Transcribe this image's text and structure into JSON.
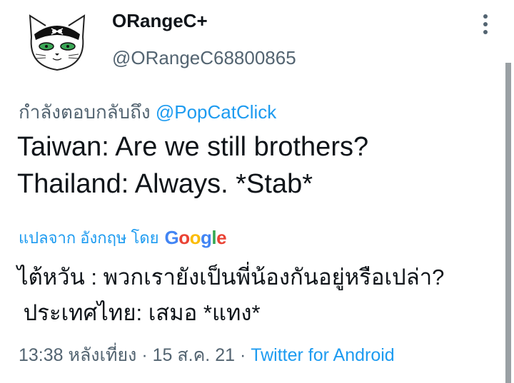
{
  "author": {
    "display_name": "ORangeC+",
    "handle": "@ORangeC68800865",
    "avatar_icon": "cat-avatar-icon"
  },
  "more_icon": "more-vertical-icon",
  "reply": {
    "prefix": "กำลังตอบกลับถึง ",
    "mention": "@PopCatClick"
  },
  "tweet": {
    "line1": "Taiwan: Are we still brothers?",
    "line2": "Thailand: Always. *Stab*"
  },
  "translate": {
    "label": "แปลจาก อังกฤษ โดย",
    "provider": "Google"
  },
  "translation": {
    "line1": "ไต้หวัน : พวกเรายังเป็นพี่น้องกันอยู่หรือเปล่า?",
    "line2": " ประเทศไทย: เสมอ *แทง*"
  },
  "meta": {
    "time": "13:38 หลังเที่ยง",
    "separator1": " · ",
    "date": "15 ส.ค. 21",
    "separator2": " · ",
    "source": "Twitter for Android"
  },
  "colors": {
    "link": "#1d9bf0",
    "secondary_text": "#536471",
    "primary_text": "#0f1419",
    "google_blue": "#4285f4",
    "google_red": "#ea4335",
    "google_yellow": "#fbbc05",
    "google_green": "#34a853"
  }
}
